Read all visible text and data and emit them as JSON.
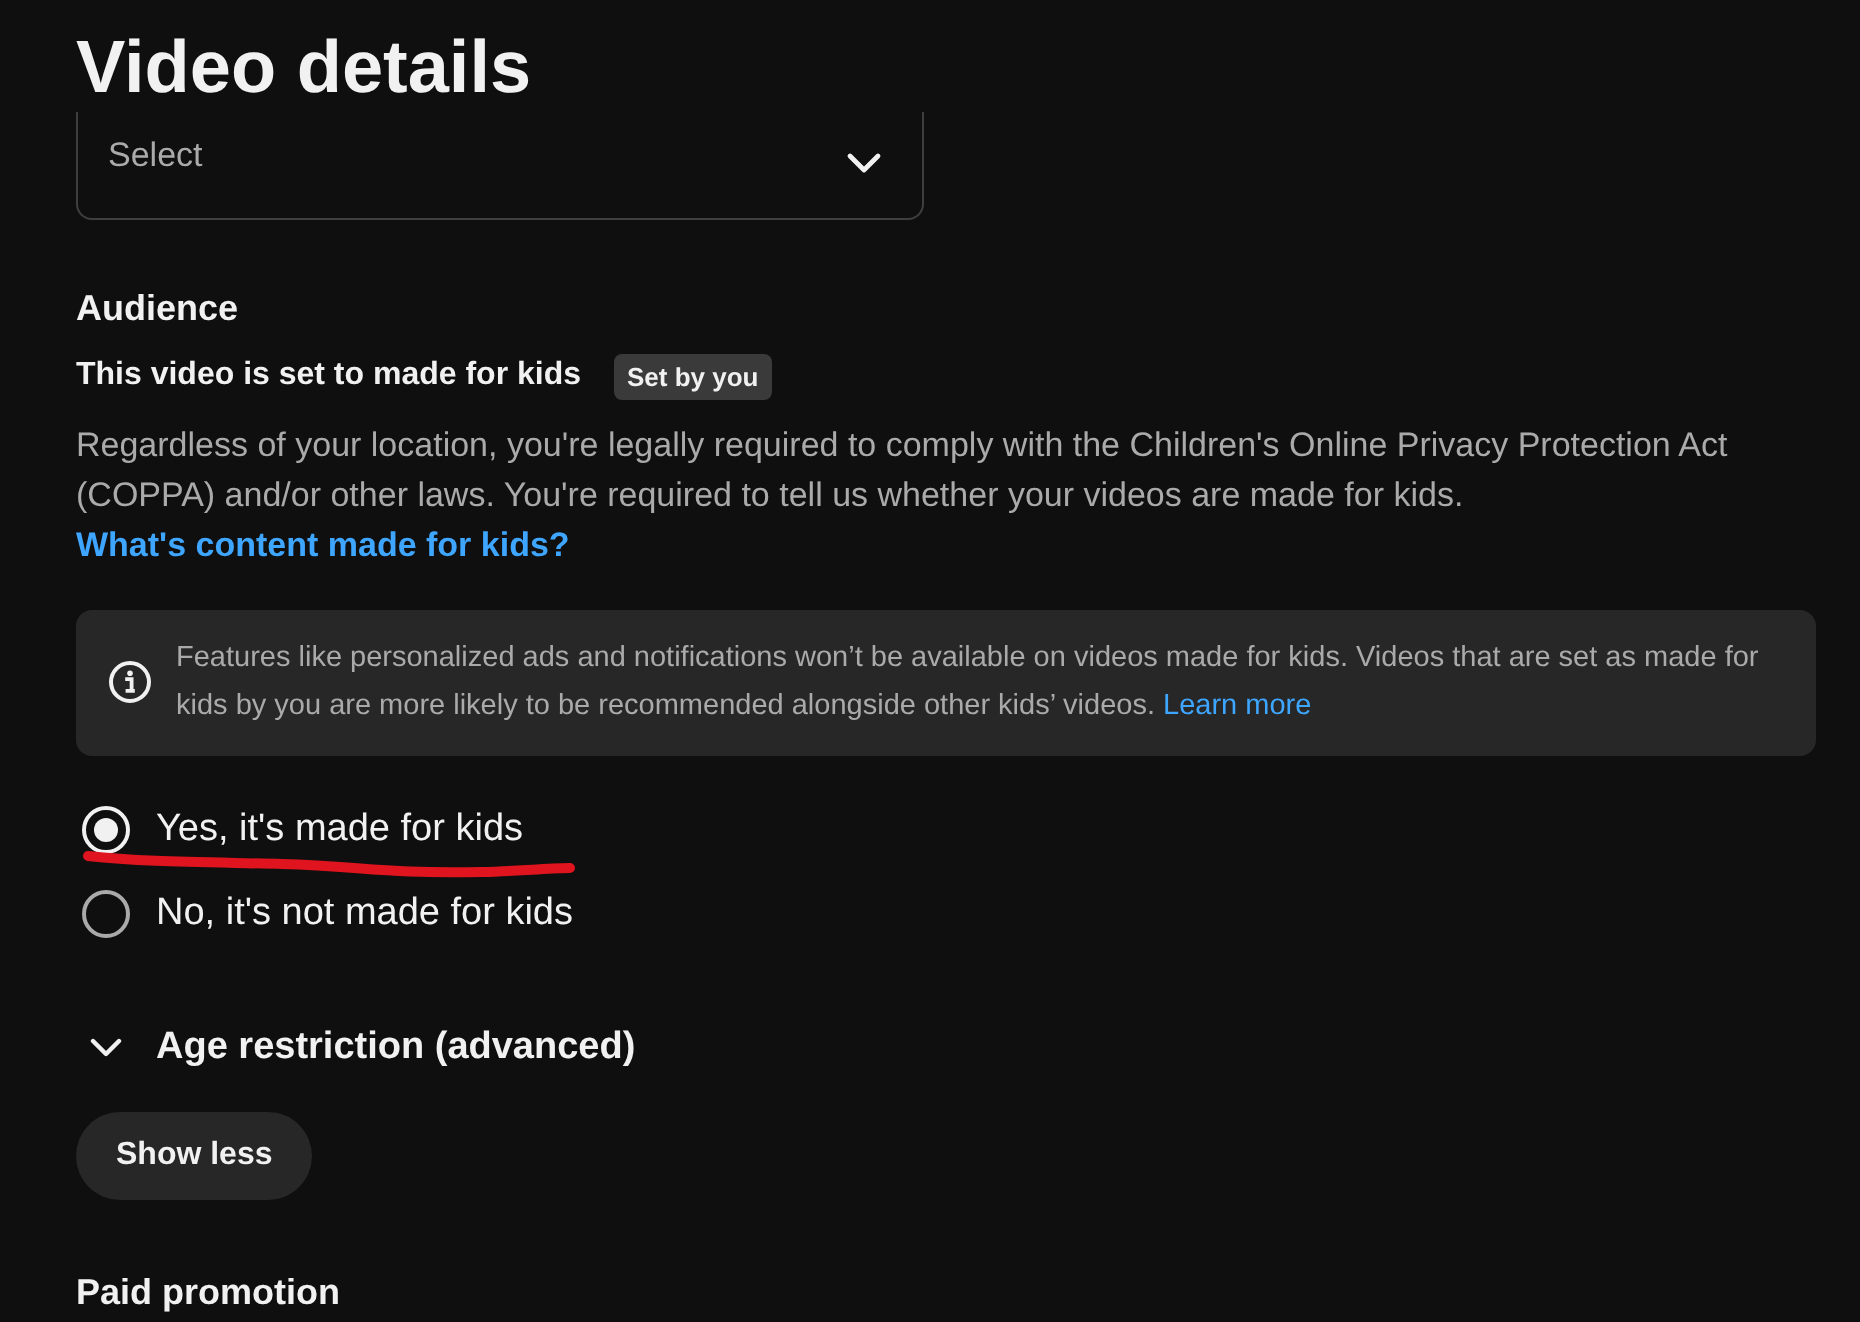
{
  "header": {
    "title": "Video details"
  },
  "category_select": {
    "placeholder": "Select"
  },
  "audience": {
    "heading": "Audience",
    "status": "This video is set to made for kids",
    "badge": "Set by you",
    "description": "Regardless of your location, you're legally required to comply with the Children's Online Privacy Protection Act (COPPA) and/or other laws. You're required to tell us whether your videos are made for kids.",
    "description_link": "What's content made for kids?",
    "notice": {
      "text": "Features like personalized ads and notifications won’t be available on videos made for kids. Videos that are set as made for kids by you are more likely to be recommended alongside other kids’ videos.",
      "link": "Learn more"
    },
    "options": [
      {
        "label": "Yes, it's made for kids",
        "selected": true
      },
      {
        "label": "No, it's not made for kids",
        "selected": false
      }
    ]
  },
  "age_restriction": {
    "label": "Age restriction (advanced)",
    "expanded": false
  },
  "show_less_button": "Show less",
  "next_section": {
    "heading": "Paid promotion"
  }
}
